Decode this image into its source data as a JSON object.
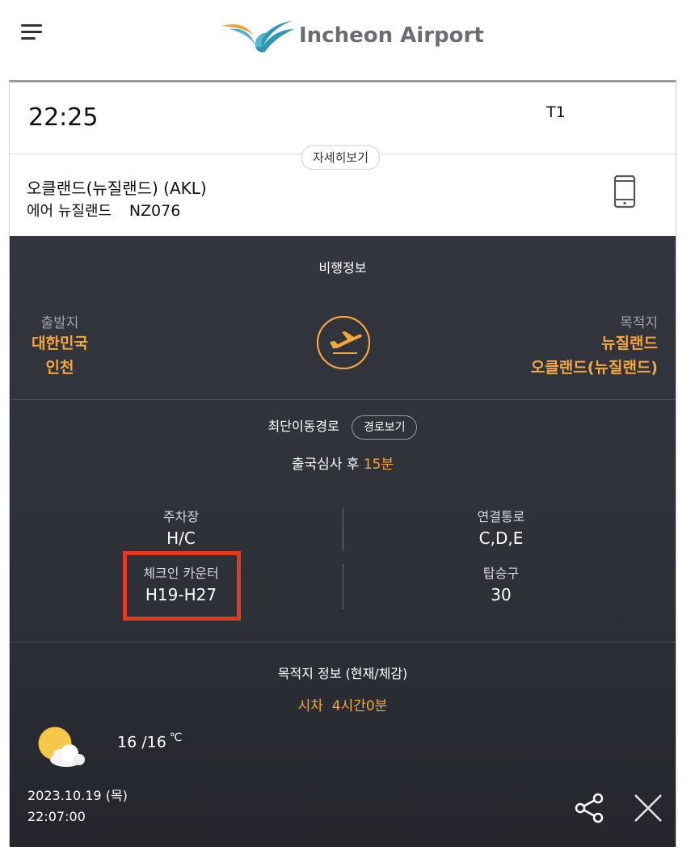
{
  "header": {
    "logo_text": "Incheon Airport",
    "menu_icon": "hamburger-menu-icon"
  },
  "flight": {
    "time": "22:25",
    "terminal": "T1",
    "detail_button": "자세히보기",
    "destination_line": "오클랜드(뉴질랜드) (AKL)",
    "airline": "에어 뉴질랜드",
    "flight_number": "NZ076",
    "phone_icon": "mobile-phone-icon"
  },
  "flight_info": {
    "title": "비행정보",
    "origin_label": "출발지",
    "origin_country": "대한민국",
    "origin_city": "인천",
    "dest_label": "목적지",
    "dest_country": "뉴질랜드",
    "dest_city": "오클랜드(뉴질랜드)",
    "departure_icon": "airplane-departure-icon"
  },
  "route": {
    "title": "최단이동경로",
    "route_button": "경로보기",
    "after_text": "출국심사 후",
    "minutes": "15분",
    "parking_label": "주차장",
    "parking_value": "H/C",
    "connect_label": "연결통로",
    "connect_value": "C,D,E",
    "checkin_label": "체크인 카운터",
    "checkin_value": "H19-H27",
    "gate_label": "탑승구",
    "gate_value": "30"
  },
  "destination_info": {
    "title": "목적지 정보 (현재/체감)",
    "time_diff_label": "시차",
    "time_diff_value": "4시간0분",
    "temperature": "16 /16",
    "unit": "℃",
    "weather_icon": "partly-cloudy-icon",
    "date": "2023.10.19 (목)",
    "clock": "22:07:00"
  },
  "actions": {
    "share_icon": "share-icon",
    "close_icon": "close-icon"
  },
  "colors": {
    "accent": "#f4a63a",
    "dark_bg": "#2f3139",
    "highlight": "#e5391e"
  }
}
